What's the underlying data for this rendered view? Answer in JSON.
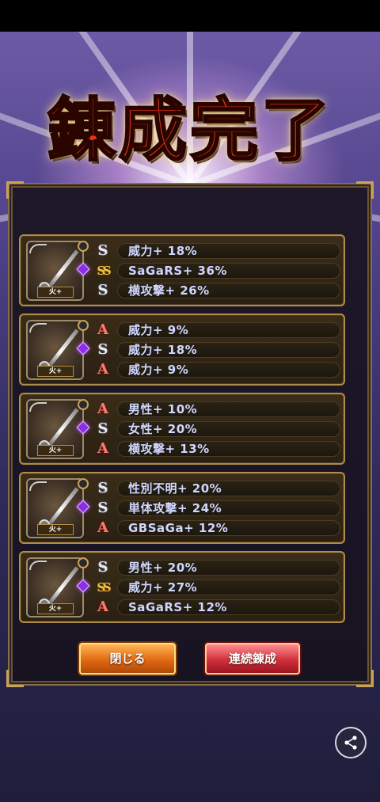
{
  "title": "錬成完了",
  "buttons": {
    "close": "閉じる",
    "repeat": "連続錬成"
  },
  "cards": [
    {
      "element_tag": "火+",
      "stats": [
        {
          "rank": "S",
          "label": "威力+ 18%"
        },
        {
          "rank": "SS",
          "label": "SaGaRS+ 36%"
        },
        {
          "rank": "S",
          "label": "横攻撃+ 26%"
        }
      ]
    },
    {
      "element_tag": "火+",
      "stats": [
        {
          "rank": "A",
          "label": "威力+ 9%"
        },
        {
          "rank": "S",
          "label": "威力+ 18%"
        },
        {
          "rank": "A",
          "label": "威力+ 9%"
        }
      ]
    },
    {
      "element_tag": "火+",
      "stats": [
        {
          "rank": "A",
          "label": "男性+ 10%"
        },
        {
          "rank": "S",
          "label": "女性+ 20%"
        },
        {
          "rank": "A",
          "label": "横攻撃+ 13%"
        }
      ]
    },
    {
      "element_tag": "火+",
      "stats": [
        {
          "rank": "S",
          "label": "性別不明+ 20%"
        },
        {
          "rank": "S",
          "label": "単体攻撃+ 24%"
        },
        {
          "rank": "A",
          "label": "GBSaGa+ 12%"
        }
      ]
    },
    {
      "element_tag": "火+",
      "stats": [
        {
          "rank": "S",
          "label": "男性+ 20%"
        },
        {
          "rank": "SS",
          "label": "威力+ 27%"
        },
        {
          "rank": "A",
          "label": "SaGaRS+ 12%"
        }
      ]
    }
  ],
  "colors": {
    "title": "#e3341c",
    "stat_text": "#cfd6ff",
    "close_button": "#e06a12",
    "repeat_button": "#d0303c",
    "frame_gold": "#b08c46"
  },
  "icons": {
    "rank_s": "S",
    "rank_ss": "SS",
    "rank_a": "A",
    "share": "share-icon"
  }
}
